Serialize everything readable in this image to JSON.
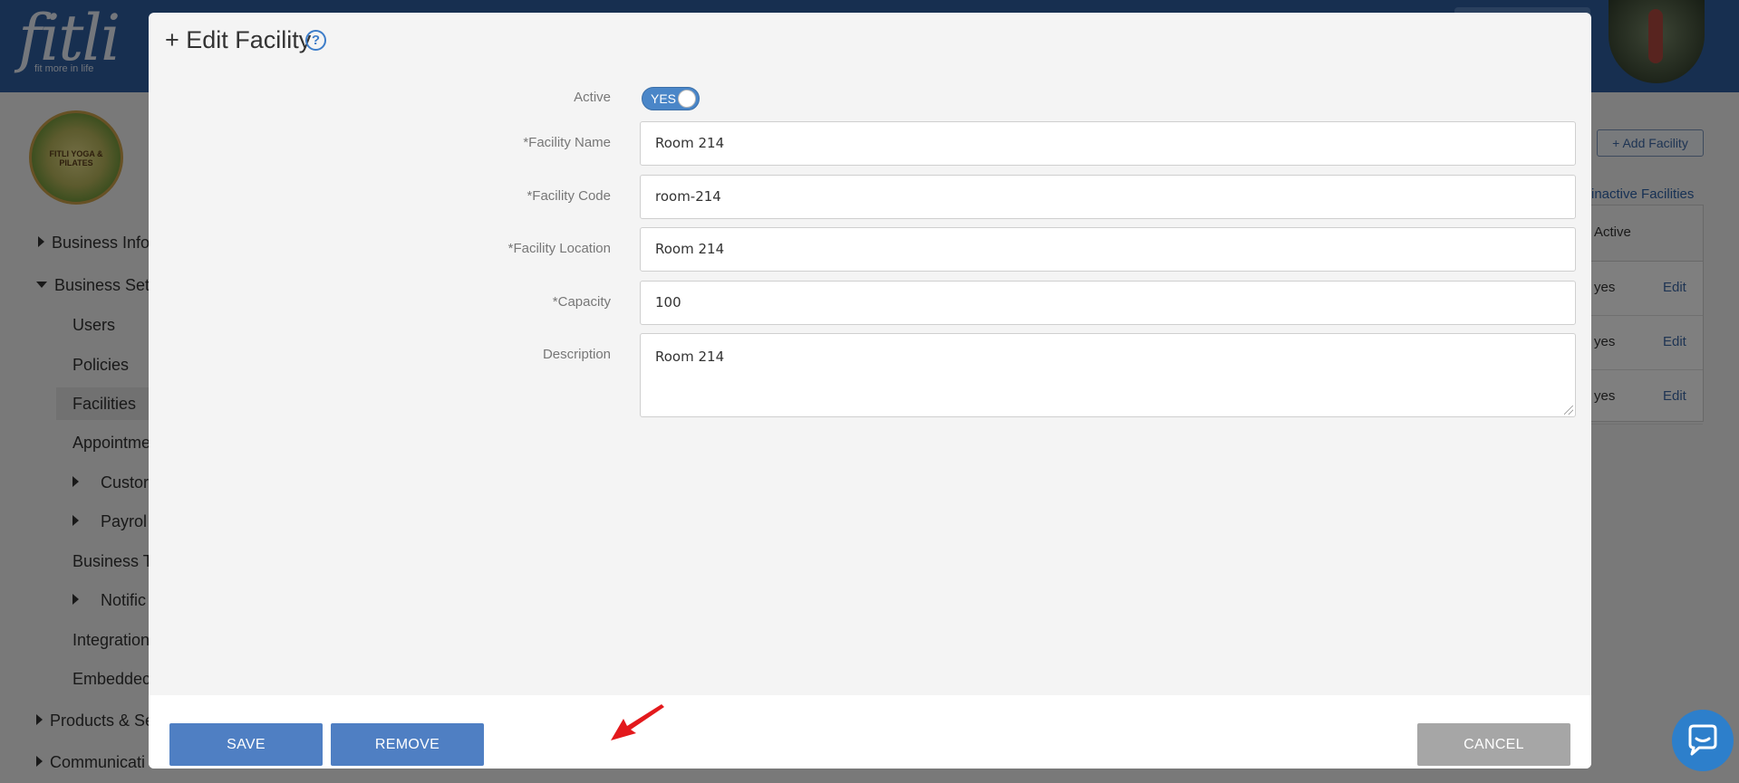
{
  "app": {
    "logo": "fitli",
    "tagline": "fit more in life",
    "brand_color": "#2f5ea0"
  },
  "background": {
    "business_logo_text": "FITLI YOGA & PILATES",
    "nav": [
      {
        "label": "Business Infor",
        "level": 0,
        "caret": "right"
      },
      {
        "label": "Business Setu",
        "level": 0,
        "caret": "down"
      },
      {
        "label": "Users",
        "level": 1
      },
      {
        "label": "Policies",
        "level": 1
      },
      {
        "label": "Facilities",
        "level": 1,
        "active": true
      },
      {
        "label": "Appointme",
        "level": 1
      },
      {
        "label": "Custor",
        "level": 2,
        "caret": "right"
      },
      {
        "label": "Payrol",
        "level": 2,
        "caret": "right"
      },
      {
        "label": "Business T",
        "level": 1
      },
      {
        "label": "Notific",
        "level": 2,
        "caret": "right"
      },
      {
        "label": "Integration",
        "level": 1
      },
      {
        "label": "Embeddec",
        "level": 1
      },
      {
        "label": "Products & Se",
        "level": 0,
        "caret": "right"
      },
      {
        "label": "Communicati",
        "level": 0,
        "caret": "right"
      }
    ],
    "add_facility_label": "+ Add Facility",
    "inactive_link": "inactive Facilities",
    "table": {
      "header": "Active",
      "rows": [
        {
          "active": "yes",
          "action": "Edit"
        },
        {
          "active": "yes",
          "action": "Edit"
        },
        {
          "active": "yes",
          "action": "Edit"
        }
      ]
    }
  },
  "modal": {
    "title": "+ Edit Facility",
    "help_icon": "question-circle-icon",
    "active": {
      "label": "Active",
      "toggle_text": "YES",
      "value": true
    },
    "fields": {
      "facility_name": {
        "label": "*Facility Name",
        "value": "Room 214"
      },
      "facility_code": {
        "label": "*Facility Code",
        "value": "room-214"
      },
      "facility_location": {
        "label": "*Facility Location",
        "value": "Room 214"
      },
      "capacity": {
        "label": "*Capacity",
        "value": "100"
      },
      "description": {
        "label": "Description",
        "value": "Room 214"
      }
    },
    "buttons": {
      "save": "SAVE",
      "remove": "REMOVE",
      "cancel": "CANCEL"
    },
    "accent_color": "#4f7fc3",
    "annotation_color": "#e3191c"
  },
  "chat_widget": {
    "icon": "chat-bubble-icon",
    "color": "#2d7fcb"
  }
}
